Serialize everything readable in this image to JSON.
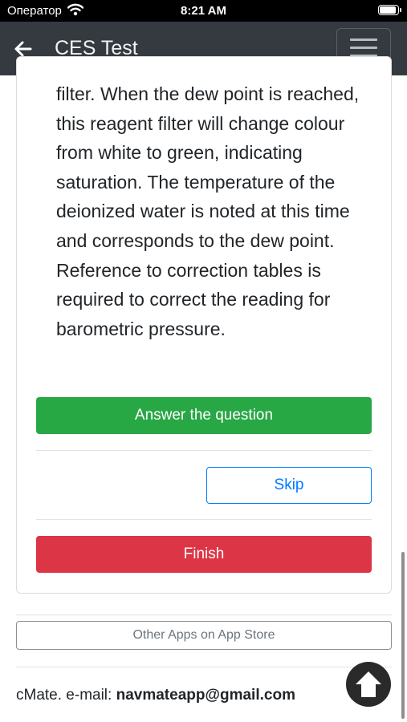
{
  "status_bar": {
    "carrier": "Оператор",
    "time": "8:21 AM"
  },
  "navbar": {
    "title": "CES Test"
  },
  "question": {
    "text": "filter. When the dew point is reached, this reagent filter will change colour from white to green, indicating saturation. The temperature of the deionized water is noted at this time and corresponds to the dew point. Reference to correction tables is required to correct the reading for barometric pressure."
  },
  "actions": {
    "answer_label": "Answer the question",
    "skip_label": "Skip",
    "finish_label": "Finish"
  },
  "footer": {
    "other_apps_label": "Other Apps on App Store",
    "contact_prefix": "cMate. e-mail: ",
    "email": "navmateapp@gmail.com"
  },
  "colors": {
    "navbar": "#343a40",
    "answer": "#28a745",
    "skip": "#007bff",
    "finish": "#dc3545"
  },
  "icons": {
    "back": "back-arrow-icon",
    "menu": "hamburger-menu-icon",
    "scroll_top": "arrow-up-icon"
  }
}
